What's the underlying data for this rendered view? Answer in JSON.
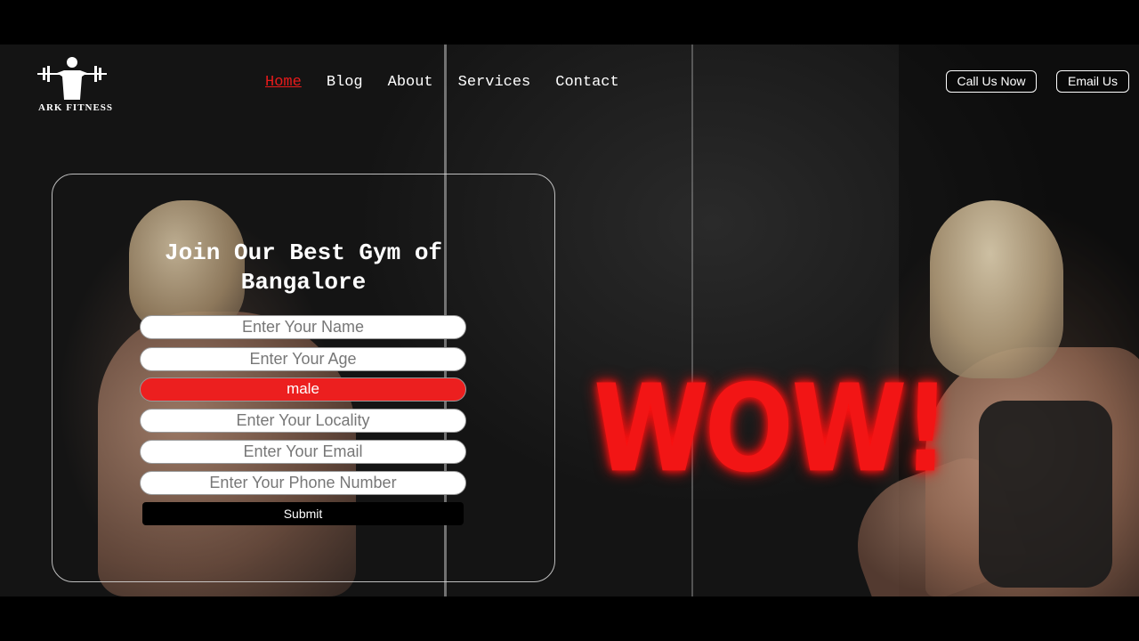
{
  "brand": {
    "name": "ARK FITNESS",
    "logo_icon": "weightlifter-icon"
  },
  "nav": {
    "items": [
      {
        "label": "Home",
        "active": true
      },
      {
        "label": "Blog",
        "active": false
      },
      {
        "label": "About",
        "active": false
      },
      {
        "label": "Services",
        "active": false
      },
      {
        "label": "Contact",
        "active": false
      }
    ]
  },
  "header_buttons": {
    "call": "Call Us Now",
    "email": "Email Us"
  },
  "form": {
    "title": "Join Our Best Gym of Bangalore",
    "name_placeholder": "Enter Your Name",
    "age_placeholder": "Enter Your Age",
    "gender_value": "male",
    "locality_placeholder": "Enter Your Locality",
    "email_placeholder": "Enter Your Email",
    "phone_placeholder": "Enter Your Phone Number",
    "submit_label": "Submit"
  },
  "hero": {
    "wow_text": "WOW!"
  },
  "colors": {
    "accent": "#e81b1b",
    "background": "#141414",
    "text": "#ffffff"
  }
}
